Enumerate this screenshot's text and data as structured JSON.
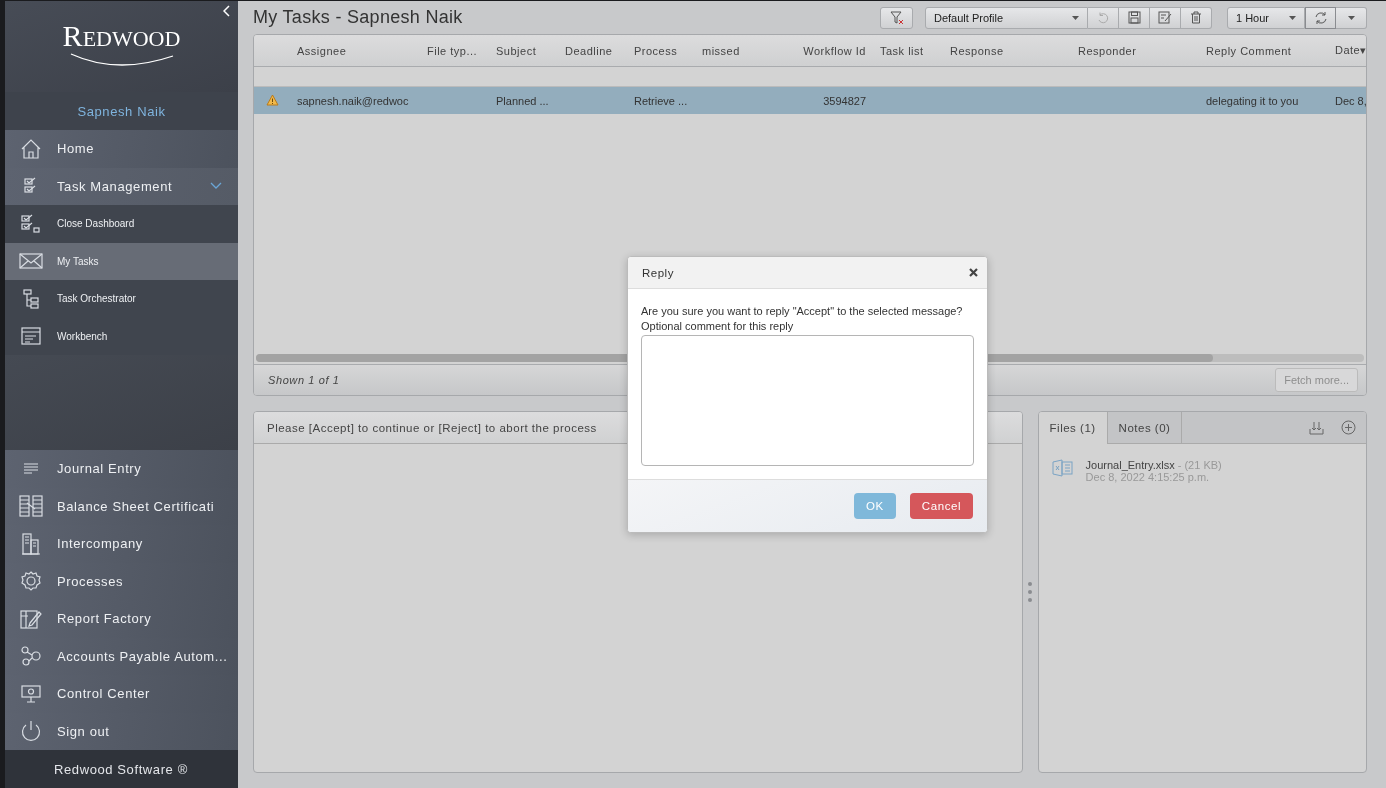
{
  "sidebar": {
    "logo": "REDWOOD",
    "user": "Sapnesh Naik",
    "top_items": [
      {
        "label": "Home",
        "kind": "main",
        "selected": false
      },
      {
        "label": "Task Management",
        "kind": "group",
        "selected": false,
        "expanded": true
      },
      {
        "label": "Close Dashboard",
        "kind": "sub",
        "selected": false
      },
      {
        "label": "My Tasks",
        "kind": "sub",
        "selected": true
      },
      {
        "label": "Task Orchestrator",
        "kind": "sub",
        "selected": false
      },
      {
        "label": "Workbench",
        "kind": "sub",
        "selected": false
      }
    ],
    "bottom_items": [
      {
        "label": "Journal Entry",
        "selected": false
      },
      {
        "label": "Balance Sheet Certificati",
        "selected": false
      },
      {
        "label": "Intercompany",
        "selected": false
      },
      {
        "label": "Processes",
        "selected": false
      },
      {
        "label": "Report Factory",
        "selected": false
      },
      {
        "label": "Accounts Payable Autom...",
        "selected": false
      },
      {
        "label": "Control Center",
        "selected": false
      },
      {
        "label": "Sign out",
        "selected": false
      }
    ],
    "footer": "Redwood Software ®"
  },
  "header": {
    "title": "My Tasks - Sapnesh Naik",
    "profile": "Default Profile",
    "interval": "1 Hour",
    "undo_disabled": true
  },
  "table": {
    "columns": [
      "Assignee",
      "File typ...",
      "Subject",
      "Deadline",
      "Process",
      "missed",
      "Workflow Id",
      "Task list",
      "Response",
      "Responder",
      "Reply Comment",
      "Date▾"
    ],
    "rows": [
      {
        "warning": true,
        "selected": true,
        "cells": [
          "sapnesh.naik@redwoc",
          "",
          "Planned ...",
          "",
          "Retrieve ...",
          "",
          "3594827",
          "",
          "",
          "",
          "delegating it to you",
          "Dec 8,"
        ]
      }
    ],
    "shown": "Shown 1 of 1",
    "fetch_more": {
      "label": "Fetch more...",
      "disabled": true
    }
  },
  "task_panel": {
    "message": "Please [Accept] to continue or [Reject] to abort the process"
  },
  "files_panel": {
    "tabs": [
      {
        "label": "Files (1)",
        "selected": true
      },
      {
        "label": "Notes (0)",
        "selected": false
      }
    ],
    "files": [
      {
        "name": "Journal_Entry.xlsx",
        "size": "- (21 KB)",
        "date": "Dec 8, 2022 4:15:25 p.m."
      }
    ]
  },
  "dialog": {
    "title": "Reply",
    "message": "Are you sure you want to reply \"Accept\" to the selected message?",
    "comment_label": "Optional comment for this reply",
    "buttons": [
      {
        "label": "OK",
        "kind": "primary"
      },
      {
        "label": "Cancel",
        "kind": "danger"
      }
    ]
  }
}
